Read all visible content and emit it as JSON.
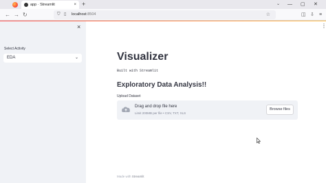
{
  "browser": {
    "tab_title": "app · Streamlit",
    "tab_close": "×",
    "new_tab": "+",
    "tab_list": "⌄",
    "window_controls": {
      "minimize": "—",
      "maximize": "▢",
      "close": "✕"
    },
    "nav": {
      "back": "←",
      "forward": "→",
      "reload": "↻"
    },
    "url_host": "localhost",
    "url_port": ":8504",
    "star": "☆",
    "toolbar_icons": {
      "pocket": "◫",
      "extensions": "⇩",
      "menu": "≡"
    }
  },
  "sidebar": {
    "close": "×",
    "select_label": "Select Activity",
    "select_value": "EDA",
    "select_chevron": "⌄"
  },
  "main": {
    "menu": "⋮",
    "title": "Visualizer",
    "built_with": "Built with Streamlit",
    "subheader": "Exploratory Data Analysis!!",
    "upload_label": "Upload Dataset",
    "dropzone_title": "Drag and drop file here",
    "dropzone_sub": "Limit 200MB per file • CSV, TXT, XLS",
    "browse_label": "Browse files"
  },
  "footer": {
    "prefix": "Made with ",
    "brand": "Streamlit"
  },
  "colors": {
    "accent": "#ff4b4b",
    "sidebar_bg": "#f0f2f6",
    "text": "#31333f"
  }
}
